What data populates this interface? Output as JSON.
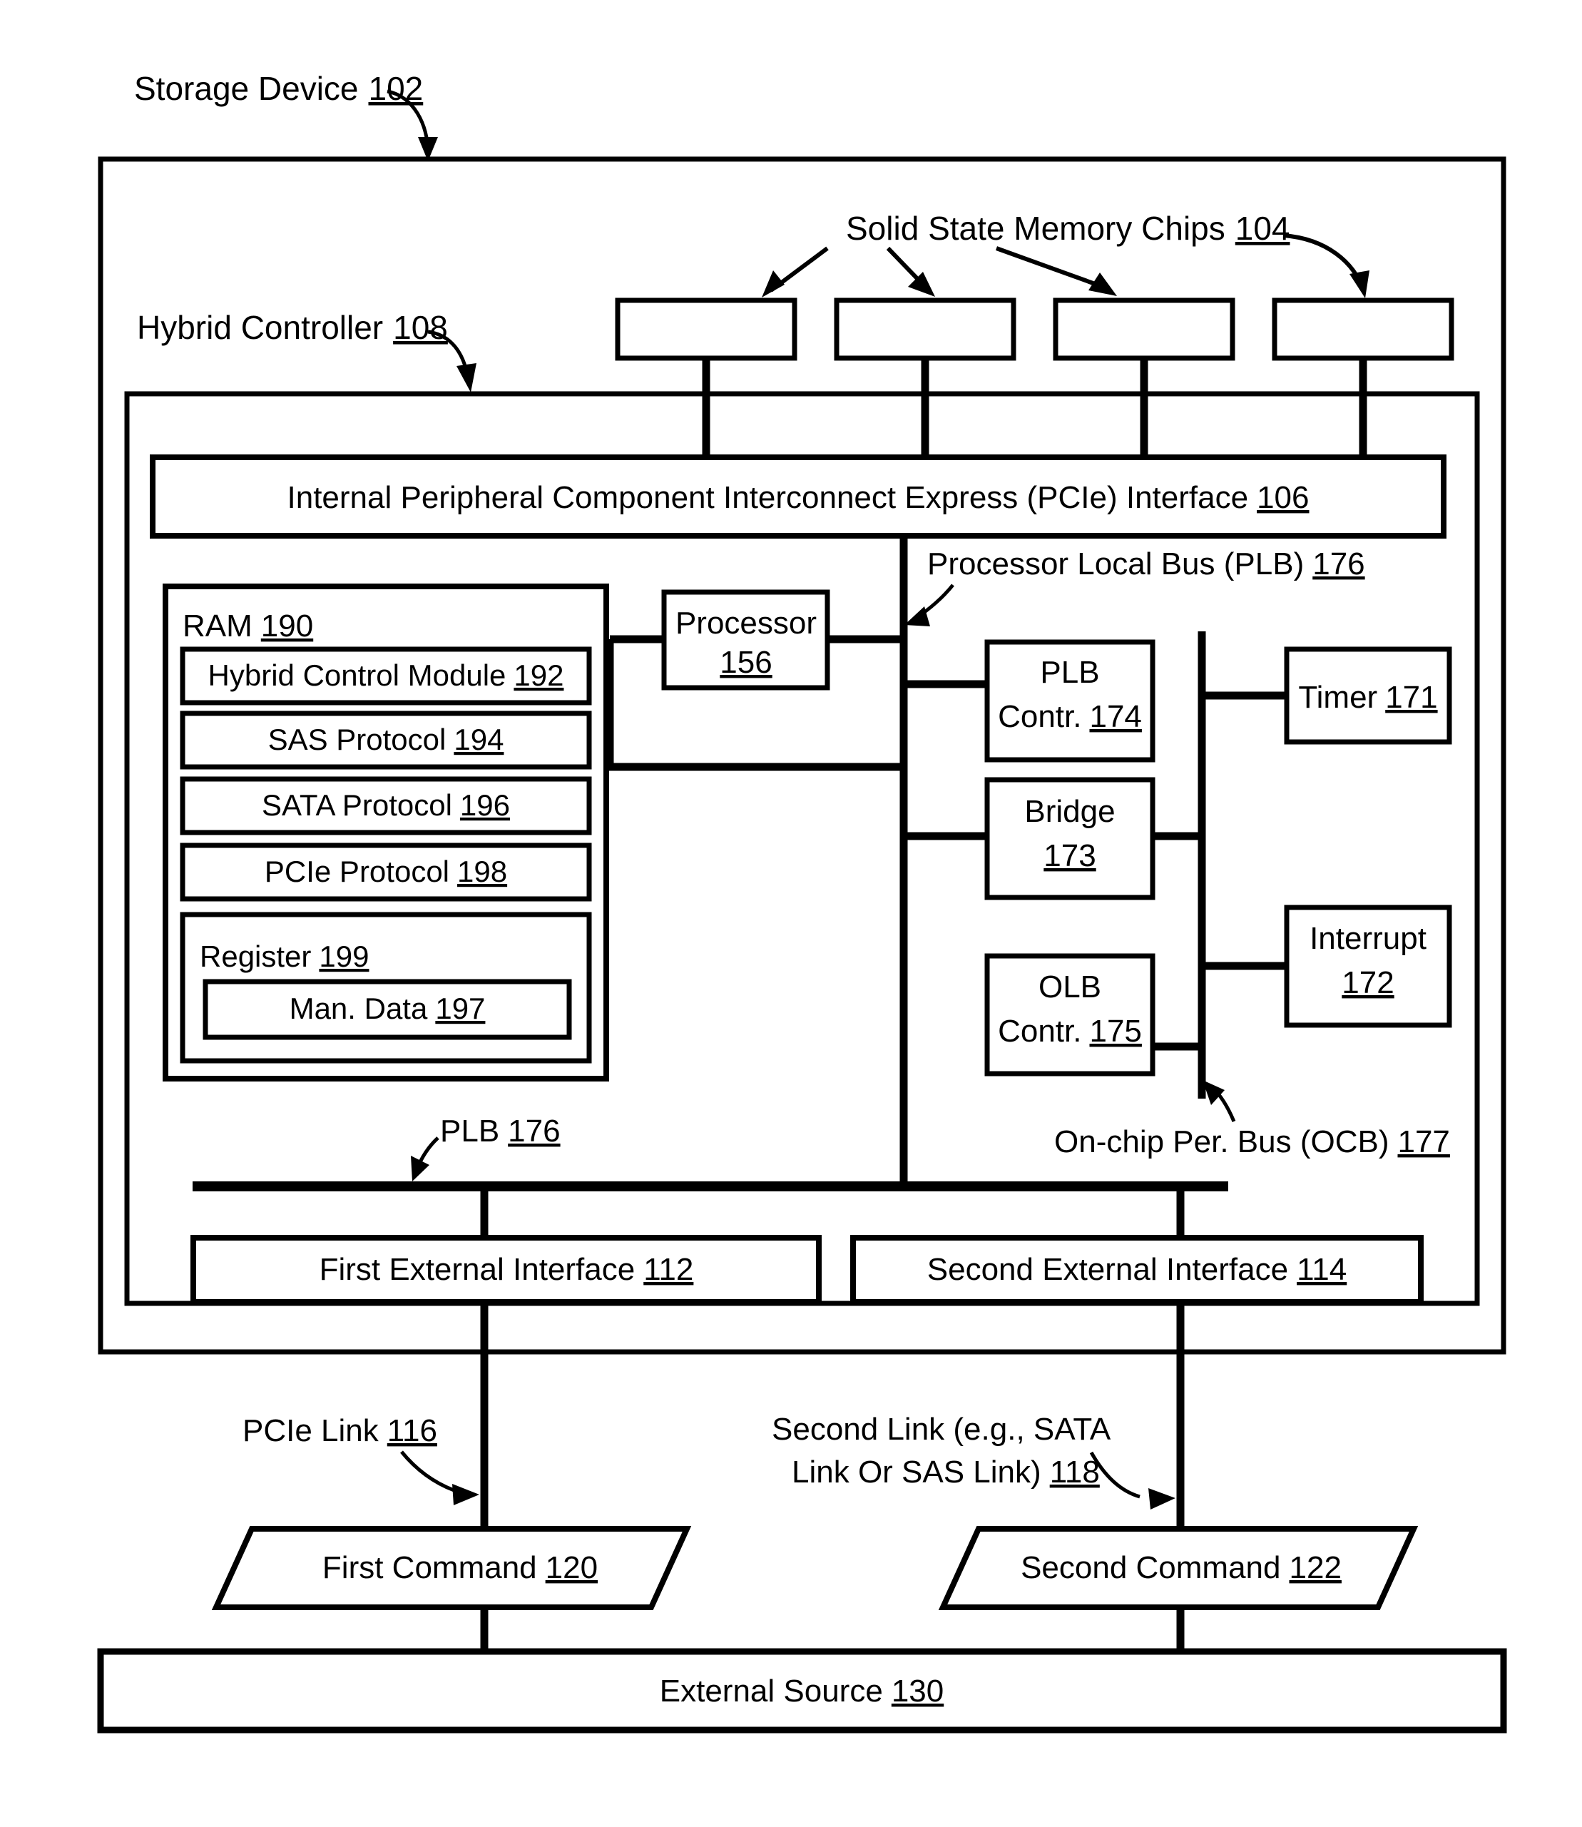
{
  "figure": {
    "type": "patent-block-diagram",
    "outer": {
      "storage_device_label": "Storage Device",
      "storage_device_ref": "102",
      "hybrid_controller_label": "Hybrid Controller",
      "hybrid_controller_ref": "108"
    },
    "memory_chips": {
      "label": "Solid State Memory Chips",
      "ref": "104",
      "count": 4,
      "chips": [
        "",
        "",
        "",
        ""
      ]
    },
    "pcie_interface": {
      "label": "Internal Peripheral Component Interconnect Express (PCIe) Interface",
      "ref": "106"
    },
    "ram": {
      "label": "RAM",
      "ref": "190",
      "modules": [
        {
          "label": "Hybrid Control Module",
          "ref": "192"
        },
        {
          "label": "SAS Protocol",
          "ref": "194"
        },
        {
          "label": "SATA Protocol",
          "ref": "196"
        },
        {
          "label": "PCIe Protocol",
          "ref": "198"
        }
      ],
      "register": {
        "label": "Register",
        "ref": "199",
        "inner": {
          "label": "Man. Data",
          "ref": "197"
        }
      }
    },
    "processor": {
      "line1": "Processor",
      "ref": "156"
    },
    "plb_bus_callout": {
      "label": "Processor Local Bus (PLB)",
      "ref": "176"
    },
    "plb_bus_bottom_callout": {
      "label": "PLB",
      "ref": "176"
    },
    "ocb_bus_callout": {
      "label": "On-chip Per. Bus (OCB)",
      "ref": "177"
    },
    "controllers": [
      {
        "line1": "PLB",
        "line2": "Contr.",
        "ref": "174",
        "name": "plb-controller"
      },
      {
        "line1": "Bridge",
        "line2": "",
        "ref": "173",
        "name": "bridge"
      },
      {
        "line1": "OLB",
        "line2": "Contr.",
        "ref": "175",
        "name": "olb-controller"
      }
    ],
    "peripherals": [
      {
        "line1": "Timer",
        "line2": "",
        "ref": "171",
        "name": "timer",
        "inline": true
      },
      {
        "line1": "Interrupt",
        "line2": "",
        "ref": "172",
        "name": "interrupt",
        "inline": false
      }
    ],
    "external_interfaces": [
      {
        "label": "First External Interface",
        "ref": "112",
        "name": "first-external-interface"
      },
      {
        "label": "Second External Interface",
        "ref": "114",
        "name": "second-external-interface"
      }
    ],
    "links": [
      {
        "line1": "PCIe Link",
        "line2": "",
        "ref": "116",
        "name": "pcie-link"
      },
      {
        "line1": "Second Link (e.g., SATA",
        "line2": "Link Or SAS Link)",
        "ref": "118",
        "name": "second-link"
      }
    ],
    "commands": [
      {
        "label": "First Command",
        "ref": "120",
        "name": "first-command"
      },
      {
        "label": "Second Command",
        "ref": "122",
        "name": "second-command"
      }
    ],
    "external_source": {
      "label": "External Source",
      "ref": "130"
    },
    "colors": {
      "stroke": "#000000",
      "fill": "#ffffff"
    }
  }
}
